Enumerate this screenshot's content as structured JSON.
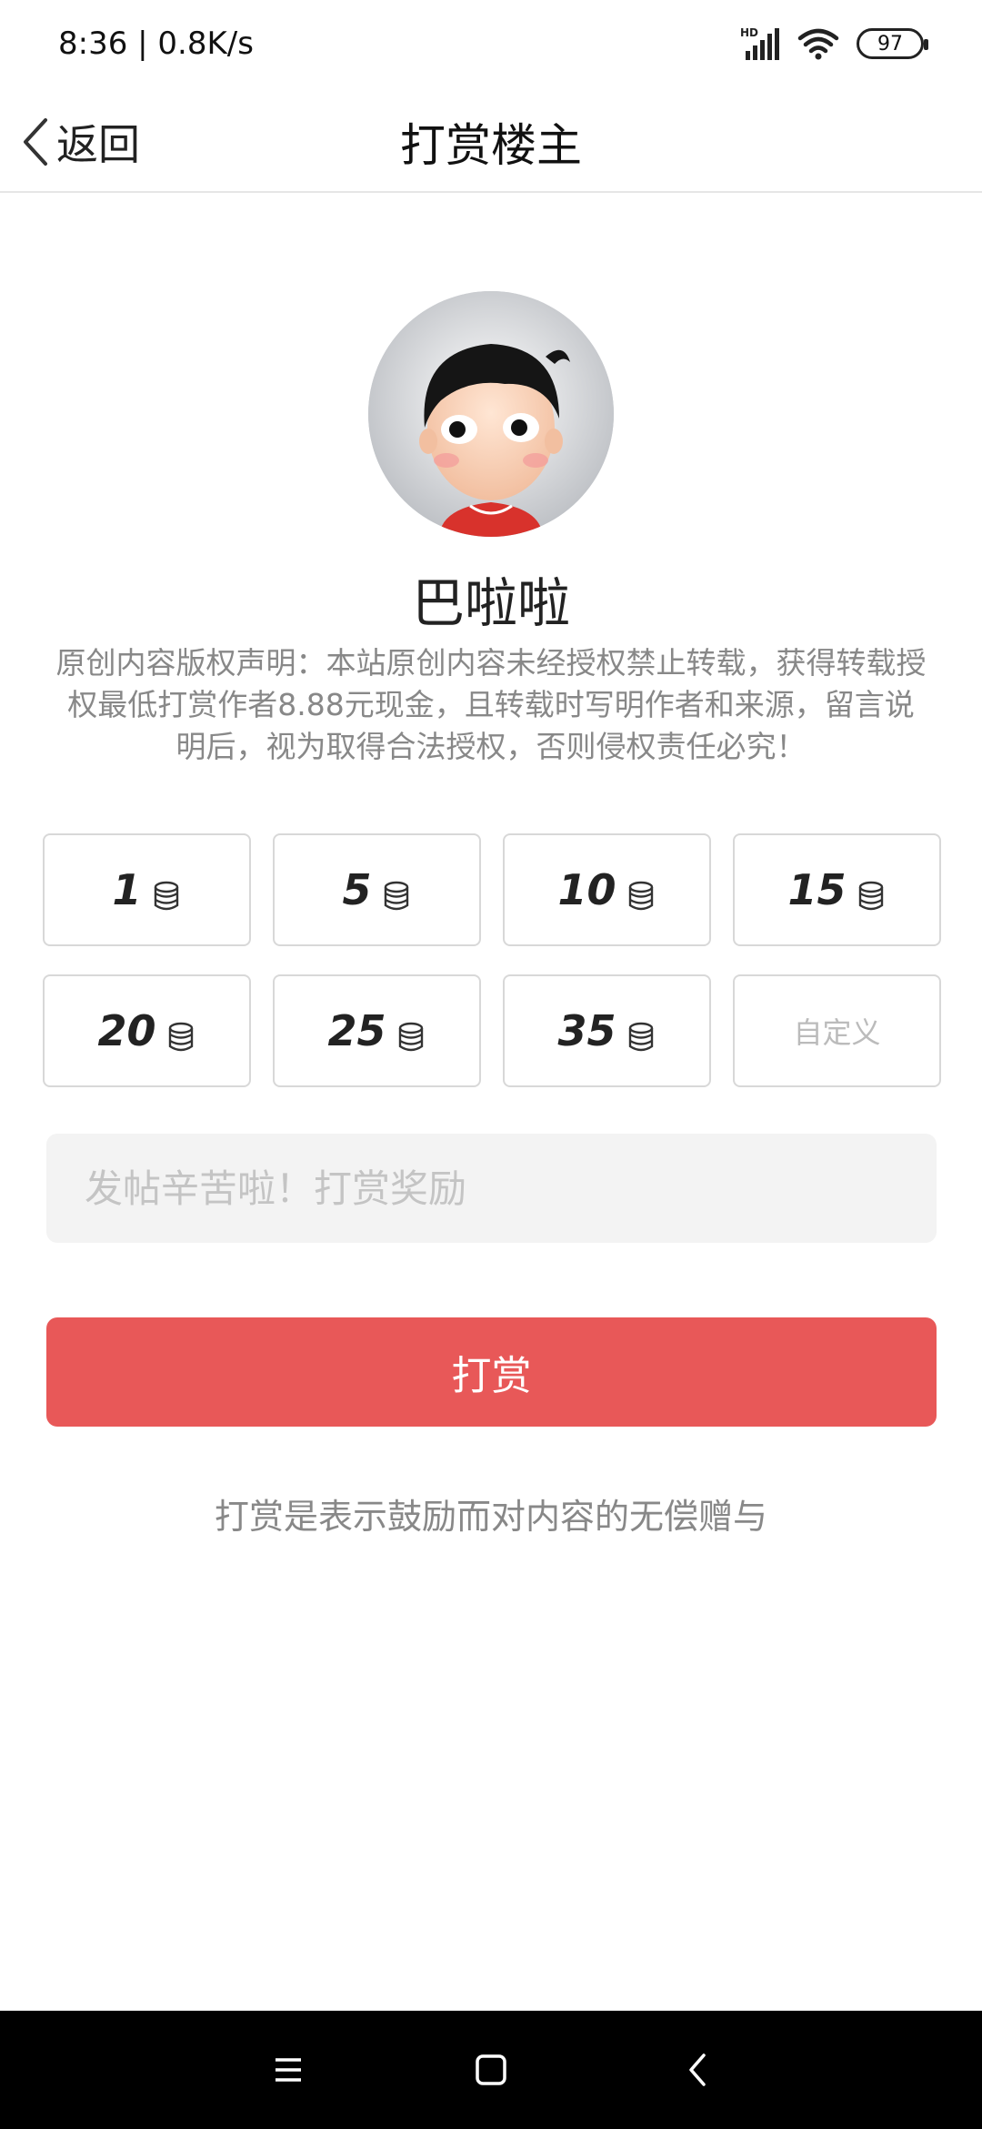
{
  "status_bar": {
    "time": "8:36 | 0.8K/s",
    "battery": "97",
    "icons": [
      "hd-signal-icon",
      "wifi-icon",
      "battery-icon"
    ]
  },
  "nav": {
    "back_label": "返回",
    "title": "打赏楼主"
  },
  "author": {
    "name": "巴啦啦"
  },
  "notice": "原创内容版权声明：本站原创内容未经授权禁止转载，获得转载授权最低打赏作者8.88元现金，且转载时写明作者和来源，留言说明后，视为取得合法授权，否则侵权责任必究！",
  "amounts": [
    {
      "value": "1"
    },
    {
      "value": "5"
    },
    {
      "value": "10"
    },
    {
      "value": "15"
    },
    {
      "value": "20"
    },
    {
      "value": "25"
    },
    {
      "value": "35"
    }
  ],
  "custom_label": "自定义",
  "message": {
    "placeholder": "发帖辛苦啦！打赏奖励",
    "value": ""
  },
  "submit_label": "打赏",
  "footer_note": "打赏是表示鼓励而对内容的无偿赠与",
  "colors": {
    "accent": "#e85858",
    "text_primary": "#222222",
    "text_secondary": "#888888",
    "input_bg": "#f3f3f3"
  }
}
